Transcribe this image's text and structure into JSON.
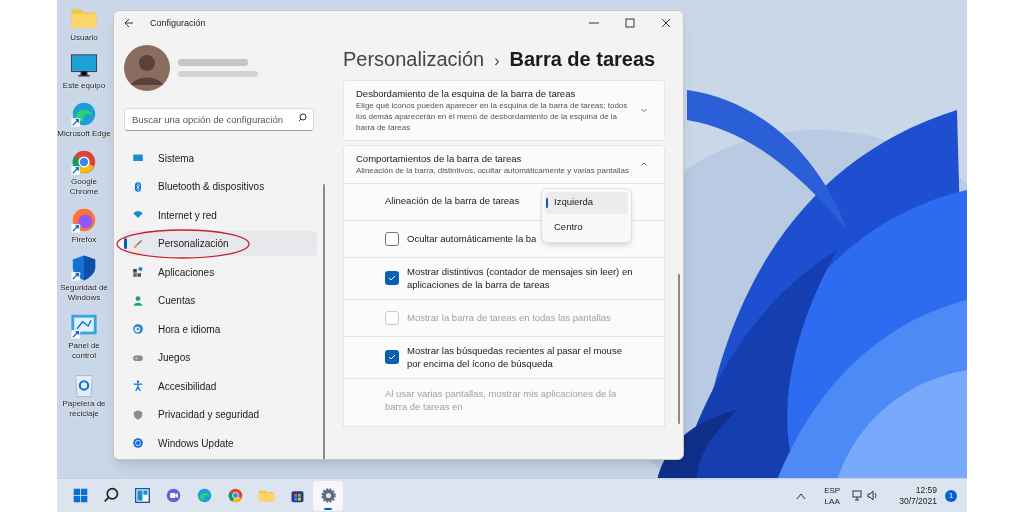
{
  "desktop_icons": [
    {
      "kind": "folder",
      "label": "Usuario"
    },
    {
      "kind": "monitor",
      "label": "Este equipo"
    },
    {
      "kind": "edge",
      "label": "Microsoft Edge"
    },
    {
      "kind": "chrome",
      "label": "Google Chrome"
    },
    {
      "kind": "firefox",
      "label": "Firefox"
    },
    {
      "kind": "shield",
      "label": "Seguridad de Windows"
    },
    {
      "kind": "panel",
      "label": "Panel de control"
    },
    {
      "kind": "recycle",
      "label": "Papelera de reciclaje"
    }
  ],
  "window": {
    "title": "Configuración",
    "search": {
      "placeholder": "Buscar una opción de configuración"
    },
    "nav": [
      {
        "kind": "system",
        "label": "Sistema",
        "selected": false,
        "circled": false
      },
      {
        "kind": "bluetooth",
        "label": "Bluetooth & dispositivos",
        "selected": false,
        "circled": false
      },
      {
        "kind": "wifi",
        "label": "Internet y red",
        "selected": false,
        "circled": false
      },
      {
        "kind": "brush",
        "label": "Personalización",
        "selected": true,
        "circled": true
      },
      {
        "kind": "apps",
        "label": "Aplicaciones",
        "selected": false,
        "circled": false
      },
      {
        "kind": "person",
        "label": "Cuentas",
        "selected": false,
        "circled": false
      },
      {
        "kind": "clock",
        "label": "Hora e idioma",
        "selected": false,
        "circled": false
      },
      {
        "kind": "gamepad",
        "label": "Juegos",
        "selected": false,
        "circled": false
      },
      {
        "kind": "accessibility",
        "label": "Accesibilidad",
        "selected": false,
        "circled": false
      },
      {
        "kind": "shield",
        "label": "Privacidad y seguridad",
        "selected": false,
        "circled": false
      },
      {
        "kind": "update",
        "label": "Windows Update",
        "selected": false,
        "circled": false
      }
    ],
    "breadcrumb": {
      "parent": "Personalización",
      "separator": "›",
      "current": "Barra de tareas"
    },
    "sections": [
      {
        "title": "Desbordamiento de la esquina de la barra de tareas",
        "description": "Elige qué iconos pueden aparecer en la esquina de la barra de tareas; todos los demás aparecerán en el menú de desbordamiento de la esquina de la barra de tareas",
        "expanded": false
      },
      {
        "title": "Comportamientos de la barra de tareas",
        "description": "Alineación de la barra, distintivos, ocultar automáticamente y varias pantallas",
        "expanded": true
      }
    ],
    "alignment": {
      "label": "Alineación de la barra de tareas",
      "options": [
        {
          "label": "Izquierda",
          "selected": true
        },
        {
          "label": "Centro",
          "selected": false
        }
      ]
    },
    "options": [
      {
        "label": "Ocultar automáticamente la ba",
        "checked": false,
        "disabled": false
      },
      {
        "label": "Mostrar distintivos (contador de mensajes sin leer) en aplicaciones de la barra de tareas",
        "checked": true,
        "disabled": false
      },
      {
        "label": "Mostrar la barra de tareas en todas las pantallas",
        "checked": false,
        "disabled": true
      },
      {
        "label": "Mostrar las búsquedas recientes al pasar el mouse por encima del ícono de búsqueda",
        "checked": true,
        "disabled": false
      }
    ],
    "multi_display": {
      "label": "Al usar varias pantallas, mostrar mis aplicaciones de la barra de tareas en",
      "disabled": true
    }
  },
  "taskbar": {
    "apps": [
      {
        "kind": "start",
        "active": false
      },
      {
        "kind": "search",
        "active": false
      },
      {
        "kind": "widgets",
        "active": false
      },
      {
        "kind": "chat",
        "active": false
      },
      {
        "kind": "edge",
        "active": false
      },
      {
        "kind": "chrome",
        "active": false
      },
      {
        "kind": "explorer",
        "active": false
      },
      {
        "kind": "store",
        "active": false
      },
      {
        "kind": "settings",
        "active": true
      }
    ],
    "language": [
      "ESP",
      "LAA"
    ],
    "time": "12:59",
    "date": "30/7/2021",
    "notifications": "1"
  }
}
